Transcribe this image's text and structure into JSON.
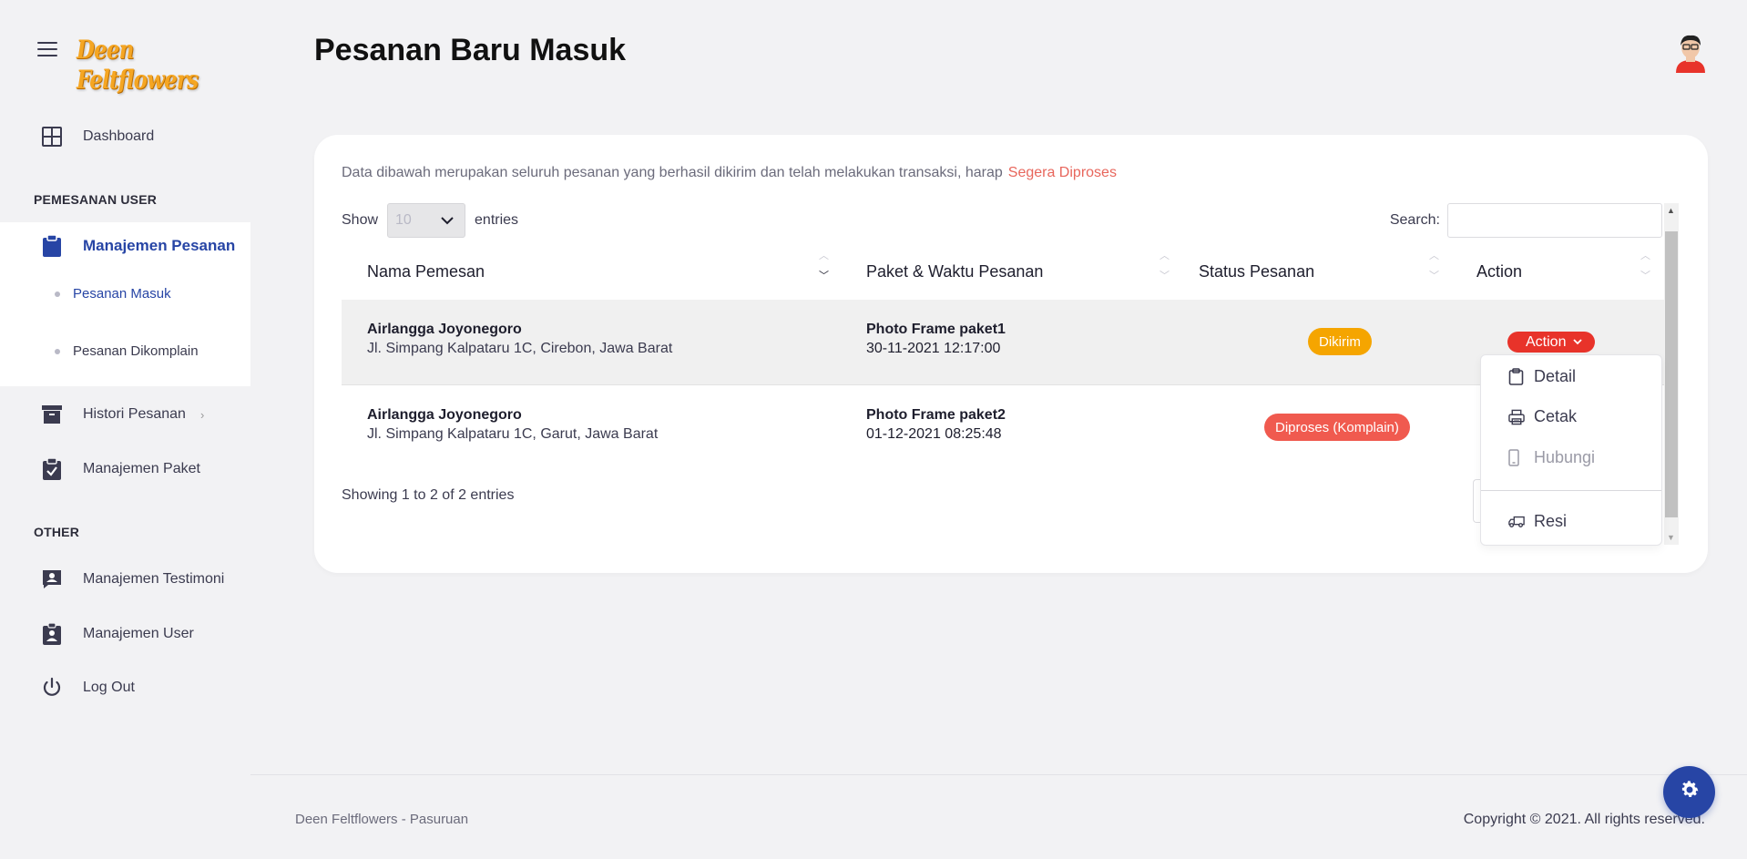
{
  "brand": {
    "logo_text": "Deen Feltflowers",
    "logo_color": "#f5a623"
  },
  "colors": {
    "primary": "#2745a5",
    "danger": "#e8332a",
    "warning": "#f5a500",
    "complain": "#f05a4f"
  },
  "sidebar": {
    "dashboard": {
      "label": "Dashboard",
      "icon": "grid-icon"
    },
    "section_user": "PEMESANAN USER",
    "manajemen_pesanan": {
      "label": "Manajemen Pesanan",
      "icon": "clipboard-icon"
    },
    "sub_items": [
      {
        "label": "Pesanan Masuk",
        "active": true
      },
      {
        "label": "Pesanan Dikomplain",
        "active": false
      }
    ],
    "histori_pesanan": {
      "label": "Histori Pesanan",
      "icon": "archive-icon",
      "chevron": "›"
    },
    "manajemen_paket": {
      "label": "Manajemen Paket",
      "icon": "clipboard-check-icon"
    },
    "section_other": "OTHER",
    "manajemen_testimoni": {
      "label": "Manajemen Testimoni",
      "icon": "chat-person-icon"
    },
    "manajemen_user": {
      "label": "Manajemen User",
      "icon": "badge-person-icon"
    },
    "logout": {
      "label": "Log Out",
      "icon": "power-icon"
    }
  },
  "header": {
    "title": "Pesanan Baru Masuk"
  },
  "card": {
    "intro": "Data dibawah merupakan seluruh pesanan yang berhasil dikirim dan telah melakukan transaksi, harap",
    "intro_highlight": "Segera Diproses",
    "show_label": "Show",
    "entries_value": "10",
    "entries_label": "entries",
    "search_label": "Search:",
    "search_value": "",
    "columns": [
      "Nama Pemesan",
      "Paket & Waktu Pesanan",
      "Status Pesanan",
      "Action"
    ],
    "rows": [
      {
        "name": "Airlangga Joyonegoro",
        "address": "Jl. Simpang Kalpataru 1C, Cirebon, Jawa Barat",
        "package": "Photo Frame paket1",
        "time": "30-11-2021 12:17:00",
        "status": "Dikirim"
      },
      {
        "name": "Airlangga Joyonegoro",
        "address": "Jl. Simpang Kalpataru 1C, Garut, Jawa Barat",
        "package": "Photo Frame paket2",
        "time": "01-12-2021 08:25:48",
        "status": "Diproses (Komplain)"
      }
    ],
    "action_label": "Action",
    "footer_info": "Showing 1 to 2 of 2 entries"
  },
  "action_menu": {
    "items": [
      {
        "label": "Detail",
        "icon": "clipboard-icon",
        "disabled": false
      },
      {
        "label": "Cetak",
        "icon": "printer-icon",
        "disabled": false
      },
      {
        "label": "Hubungi",
        "icon": "phone-icon",
        "disabled": true
      },
      {
        "label": "Resi",
        "icon": "truck-icon",
        "disabled": false
      }
    ]
  },
  "footer": {
    "left": "Deen Feltflowers - Pasuruan",
    "right": "Copyright © 2021. All rights reserved."
  }
}
